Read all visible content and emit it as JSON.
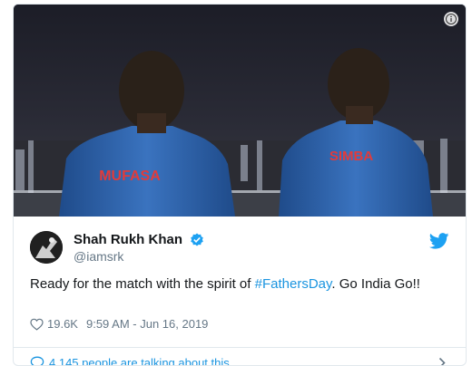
{
  "tweet": {
    "media": {
      "left_jersey_text": "MUFASA",
      "right_jersey_text": "SIMBA"
    },
    "author": {
      "display_name": "Shah Rukh Khan",
      "handle": "@iamsrk",
      "verified": true
    },
    "text": {
      "before": "Ready for the match with the spirit of ",
      "hashtag": "#FathersDay",
      "after": ". Go India Go!!"
    },
    "likes": "19.6K",
    "timestamp": "9:59 AM - Jun 16, 2019",
    "conversation_text": "4,145 people are talking about this"
  },
  "colors": {
    "link": "#1b95e0",
    "muted": "#657786",
    "jersey": "#2e63a8",
    "jersey_text": "#e23b3b"
  },
  "icons": [
    "info-icon",
    "verified-badge-icon",
    "twitter-bird-icon",
    "heart-icon",
    "speech-bubble-icon",
    "chevron-right-icon"
  ]
}
